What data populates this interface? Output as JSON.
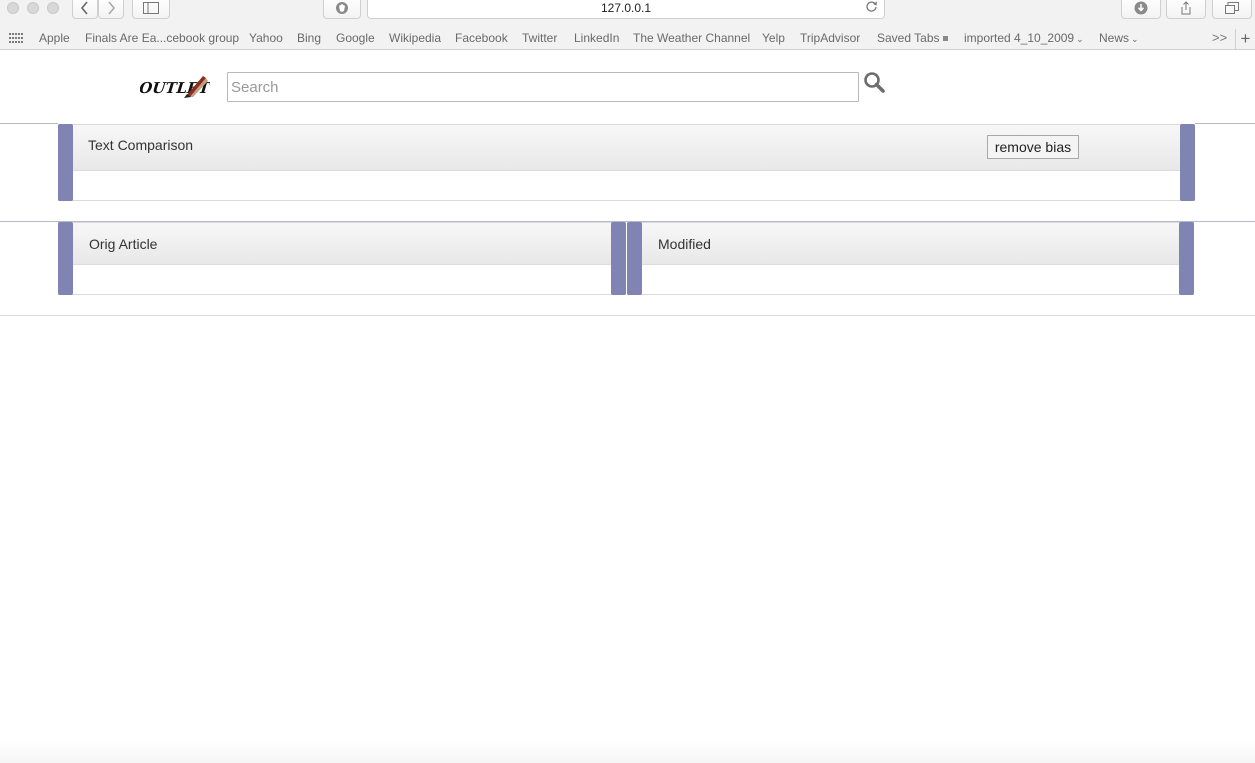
{
  "browser": {
    "address": "127.0.0.1",
    "bookmarks": [
      {
        "label": "Apple"
      },
      {
        "label": "Finals Are Ea...cebook group"
      },
      {
        "label": "Yahoo"
      },
      {
        "label": "Bing"
      },
      {
        "label": "Google"
      },
      {
        "label": "Wikipedia"
      },
      {
        "label": "Facebook"
      },
      {
        "label": "Twitter"
      },
      {
        "label": "LinkedIn"
      },
      {
        "label": "The Weather Channel"
      },
      {
        "label": "Yelp"
      },
      {
        "label": "TripAdvisor"
      },
      {
        "label": "Saved Tabs"
      },
      {
        "label": "imported 4_10_2009"
      },
      {
        "label": "News"
      }
    ],
    "overflow_label": ">>",
    "new_tab_label": "+"
  },
  "header": {
    "logo_text": "OUTLET",
    "search_placeholder": "Search",
    "search_value": ""
  },
  "comparison_panel": {
    "title": "Text Comparison",
    "button_label": "remove bias"
  },
  "orig_panel": {
    "title": "Orig Article"
  },
  "modified_panel": {
    "title": "Modified"
  },
  "colors": {
    "accent": "#8084b2",
    "panel_header": "#ececec",
    "logo_mark": "#8b2e1e"
  },
  "icons": [
    "back-icon",
    "forward-icon",
    "sidebar-icon",
    "shield-icon",
    "reload-icon",
    "download-icon",
    "share-icon",
    "tabs-icon",
    "apps-grid-icon",
    "search-icon"
  ]
}
